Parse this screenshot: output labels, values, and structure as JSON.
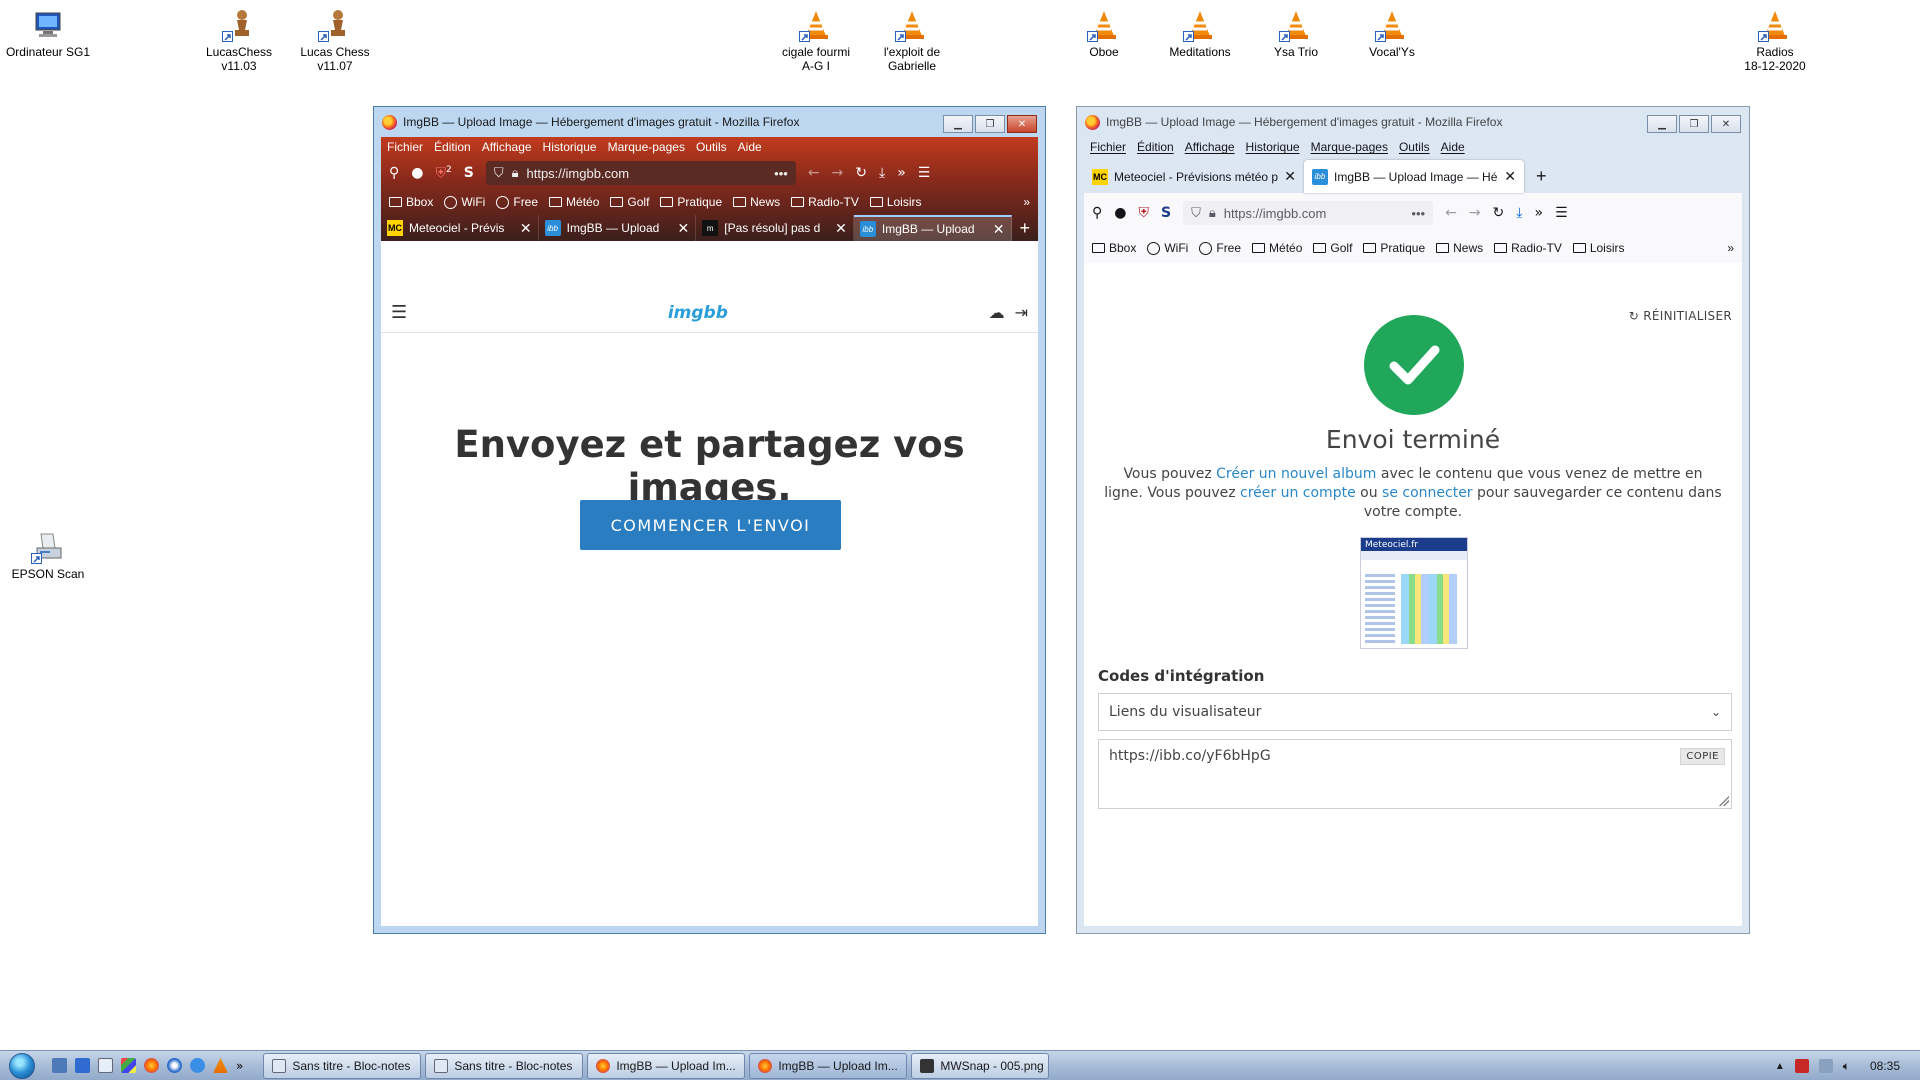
{
  "desktop": {
    "icons": [
      {
        "label": "Ordinateur SG1"
      },
      {
        "label": "LucasChess\nv11.03"
      },
      {
        "label": "Lucas Chess\nv11.07"
      },
      {
        "label": "cigale fourmi\nA-G I"
      },
      {
        "label": "l'exploit de\nGabrielle"
      },
      {
        "label": "Oboe"
      },
      {
        "label": "Meditations"
      },
      {
        "label": "Ysa Trio"
      },
      {
        "label": "Vocal'Ys"
      },
      {
        "label": "Radios\n18-12-2020"
      },
      {
        "label": "EPSON Scan"
      }
    ]
  },
  "left_window": {
    "title": "ImgBB — Upload Image — Hébergement d'images gratuit - Mozilla Firefox",
    "menu": [
      "Fichier",
      "Édition",
      "Affichage",
      "Historique",
      "Marque-pages",
      "Outils",
      "Aide"
    ],
    "url": "https://imgbb.com",
    "badge": "2",
    "bookmarks": [
      "Bbox",
      "WiFi",
      "Free",
      "Météo",
      "Golf",
      "Pratique",
      "News",
      "Radio-TV",
      "Loisirs"
    ],
    "tabs": [
      {
        "label": "Meteociel - Prévis",
        "icon": "MC"
      },
      {
        "label": "ImgBB — Upload",
        "icon": "ibb"
      },
      {
        "label": "[Pas résolu] pas d",
        "icon": "m"
      },
      {
        "label": "ImgBB — Upload",
        "icon": "ibb"
      }
    ],
    "page": {
      "logo": "imgbb",
      "headline": "Envoyez et partagez vos images.",
      "button": "COMMENCER L'ENVOI"
    }
  },
  "right_window": {
    "title": "ImgBB — Upload Image — Hébergement d'images gratuit - Mozilla Firefox",
    "menu": [
      "Fichier",
      "Édition",
      "Affichage",
      "Historique",
      "Marque-pages",
      "Outils",
      "Aide"
    ],
    "tabs": [
      {
        "label": "Meteociel - Prévisions météo pour",
        "icon": "MC"
      },
      {
        "label": "ImgBB — Upload Image — Héb",
        "icon": "ibb"
      }
    ],
    "url": "https://imgbb.com",
    "bookmarks": [
      "Bbox",
      "WiFi",
      "Free",
      "Météo",
      "Golf",
      "Pratique",
      "News",
      "Radio-TV",
      "Loisirs"
    ],
    "page": {
      "reset": "RÉINITIALISER",
      "title": "Envoi terminé",
      "msg_1": "Vous pouvez ",
      "link_album": "Créer un nouvel album",
      "msg_2": " avec le contenu que vous venez de mettre en ligne. Vous pouvez ",
      "link_account": "créer un compte",
      "msg_3": " ou ",
      "link_login": "se connecter",
      "msg_4": " pour sauvegarder ce contenu dans votre compte.",
      "thumb_title": "Meteociel.fr",
      "section": "Codes d'intégration",
      "select_value": "Liens du visualisateur",
      "code": "https://ibb.co/yF6bHpG",
      "copy": "COPIE"
    }
  },
  "taskbar": {
    "tasks": [
      "Sans titre - Bloc-notes",
      "Sans titre - Bloc-notes",
      "ImgBB — Upload Im...",
      "ImgBB — Upload Im...",
      "MWSnap - 005.png"
    ],
    "clock": "08:35"
  },
  "colors": {
    "accent": "#2a7dc1",
    "success": "#20a75a",
    "link": "#2a88c8"
  }
}
